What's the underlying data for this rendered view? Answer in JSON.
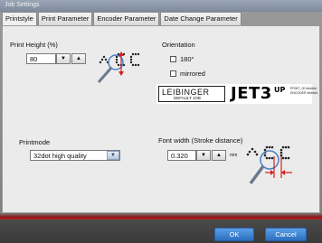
{
  "window": {
    "title": "Job Settings"
  },
  "tabs": [
    {
      "label": "Printstyle",
      "active": true
    },
    {
      "label": "Print Parameter",
      "active": false
    },
    {
      "label": "Encoder Parameter",
      "active": false
    },
    {
      "label": "Date Change Parameter",
      "active": false
    }
  ],
  "print_height": {
    "label": "Print Height (%)",
    "value": "80"
  },
  "orientation": {
    "label": "Orientation",
    "options": [
      {
        "label": "180°",
        "checked": false
      },
      {
        "label": "mirrored",
        "checked": false
      }
    ]
  },
  "logo": {
    "brand": "LEIBINGER",
    "sub": "DEFAULT JOB",
    "product": "JET3",
    "product_suffix": "UP",
    "small_text": "PRINT_00 ######\nENCODER ######"
  },
  "printmode": {
    "label": "Printmode",
    "value": "32dot high quality"
  },
  "font_width": {
    "label": "Font width (Stroke distance)",
    "value": "0.320",
    "unit": "mm"
  },
  "spin": {
    "down": "▼",
    "up": "▲"
  },
  "buttons": {
    "ok": "OK",
    "cancel": "Cancel"
  },
  "colors": {
    "accent_red": "#d42020",
    "button_blue": "#3a82d2",
    "titlebar": "#8a96a8"
  },
  "icons": {
    "combo_arrow": "chevron-down-icon",
    "height_icon": "dot-matrix-height-icon",
    "width_icon": "dot-matrix-width-icon"
  }
}
